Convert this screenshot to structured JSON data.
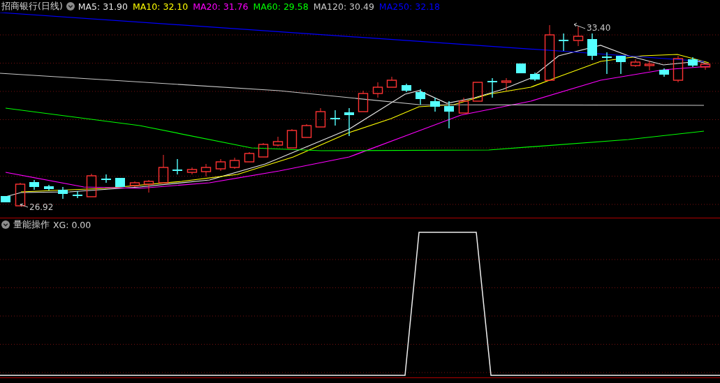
{
  "main_pane": {
    "title": "招商银行(日线)",
    "indicators": [
      {
        "label": "MA5: 31.90",
        "color": "#e6e6e6"
      },
      {
        "label": "MA10: 32.10",
        "color": "#ffff00"
      },
      {
        "label": "MA20: 31.76",
        "color": "#ff00ff"
      },
      {
        "label": "MA60: 29.58",
        "color": "#00ff00"
      },
      {
        "label": "MA120: 30.49",
        "color": "#c8c8c8"
      },
      {
        "label": "MA250: 32.18",
        "color": "#0000ff"
      }
    ],
    "high_label": "33.40",
    "low_label": "26.92"
  },
  "sub_pane": {
    "title": "量能操作",
    "value": "XG: 0.00"
  }
}
